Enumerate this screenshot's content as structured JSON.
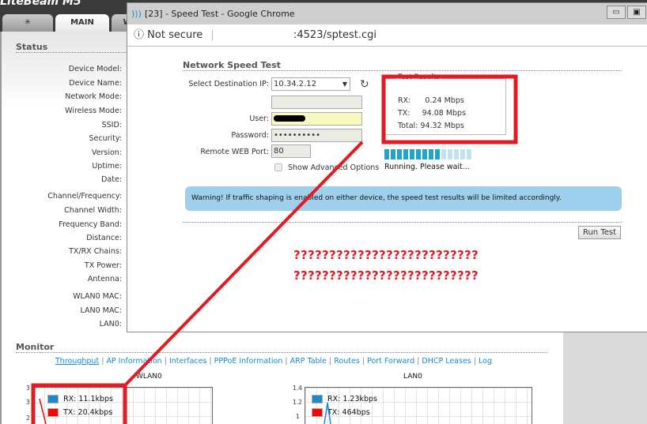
{
  "app": {
    "brand": "LiteBeam M5",
    "tabs": [
      {
        "label": "MAIN"
      },
      {
        "label": "W"
      }
    ]
  },
  "status": {
    "title": "Status",
    "labels": [
      "Device Model:",
      "Device Name:",
      "Network Mode:",
      "Wireless Mode:",
      "SSID:",
      "Security:",
      "Version:",
      "Uptime:",
      "Date:",
      "Channel/Frequency:",
      "Channel Width:",
      "Frequency Band:",
      "Distance:",
      "TX/RX Chains:",
      "TX Power:",
      "Antenna:",
      "WLAN0 MAC:",
      "LAN0 MAC:",
      "LAN0:"
    ]
  },
  "popup": {
    "window_title": "[23] - Speed Test - Google Chrome",
    "security": "Not secure",
    "url": ":4523/sptest.cgi",
    "heading": "Network Speed Test",
    "dest_label": "Select Destination IP:",
    "dest_value": "10.34.2.12",
    "user_label": "User:",
    "password_label": "Password:",
    "password_value": "••••••••••",
    "port_label": "Remote WEB Port:",
    "port_value": "80",
    "advanced_label": "Show Advanced Options",
    "results": {
      "legend": "Test Results",
      "rx": "RX:      0.24 Mbps",
      "tx": "TX:     94.08 Mbps",
      "total": "Total: 94.32 Mbps"
    },
    "progress": {
      "filled": 9,
      "total": 14
    },
    "progress_text": "Running. Please wait...",
    "warning": "Warning! If traffic shaping is enabled on either device, the speed test results will be limited accordingly.",
    "run_button": "Run Test",
    "annotation_line1": "??????????????????????????",
    "annotation_line2": "??????????????????????????"
  },
  "monitor": {
    "title": "Monitor",
    "links": [
      "Throughput",
      "AP Information",
      "Interfaces",
      "PPPoE Information",
      "ARP Table",
      "Routes",
      "Port Forward",
      "DHCP Leases",
      "Log"
    ],
    "charts": [
      {
        "title": "WLAN0",
        "rx": "RX: 11.1kbps",
        "tx": "TX: 20.4kbps",
        "yticks": [
          "3",
          "3",
          "2"
        ]
      },
      {
        "title": "LAN0",
        "rx": "RX: 1.23kbps",
        "tx": "TX: 464bps",
        "yticks": [
          "1.4",
          "1.2",
          "1"
        ]
      }
    ],
    "colors": {
      "rx": "#1e88c8",
      "tx": "#ff0000"
    }
  },
  "annotation_color": "#e21b23"
}
